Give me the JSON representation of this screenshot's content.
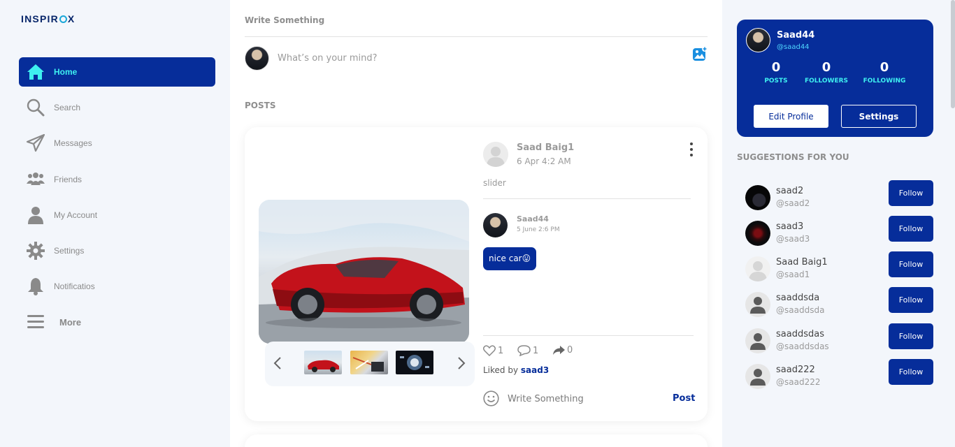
{
  "app": {
    "logo_text": "INSPIR",
    "logo_suffix": "X"
  },
  "sidebar": {
    "items": [
      {
        "label": "Home",
        "icon": "home-icon",
        "active": true
      },
      {
        "label": "Search",
        "icon": "search-icon"
      },
      {
        "label": "Messages",
        "icon": "paper-plane-icon"
      },
      {
        "label": "Friends",
        "icon": "friends-icon"
      },
      {
        "label": "My Account",
        "icon": "user-icon"
      },
      {
        "label": "Settings",
        "icon": "gear-icon"
      },
      {
        "label": "Notificatios",
        "icon": "bell-icon"
      },
      {
        "label": "More",
        "icon": "menu-icon"
      }
    ]
  },
  "composer": {
    "title": "Write Something",
    "placeholder": "What’s on your mind?",
    "image_icon": "add-image-icon"
  },
  "feed": {
    "section_label": "POSTS",
    "post": {
      "author": "Saad Baig1",
      "date": "6 Apr 4:2 AM",
      "caption": "slider",
      "image": "red-sports-car-image",
      "thumbnails": [
        "red-car-thumb",
        "desk-thumb",
        "video-thumb"
      ],
      "comment": {
        "user": "Saad44",
        "date": "5 June 2:6 PM",
        "text": "nice car😛"
      },
      "likes": "1",
      "comments": "1",
      "shares": "0",
      "liked_by_prefix": "Liked by",
      "liked_by_user": "saad3",
      "comment_placeholder": "Write Something",
      "post_button": "Post"
    }
  },
  "profile": {
    "name": "Saad44",
    "handle": "@saad44",
    "posts": "0",
    "followers": "0",
    "following": "0",
    "posts_label": "POSTS",
    "followers_label": "FOLLOWERS",
    "following_label": "FOLLOWING",
    "edit_button": "Edit Profile",
    "settings_button": "Settings"
  },
  "suggestions": {
    "title": "SUGGESTIONS FOR YOU",
    "follow_label": "Follow",
    "items": [
      {
        "name": "saad2",
        "handle": "@saad2"
      },
      {
        "name": "saad3",
        "handle": "@saad3"
      },
      {
        "name": "Saad Baig1",
        "handle": "@saad1"
      },
      {
        "name": "saaddsda",
        "handle": "@saaddsda"
      },
      {
        "name": "saaddsdas",
        "handle": "@saaddsdas"
      },
      {
        "name": "saad222",
        "handle": "@saad222"
      }
    ]
  },
  "colors": {
    "brand": "#062d9a",
    "accent": "#3ef0f0",
    "background": "#f3f6fb"
  }
}
